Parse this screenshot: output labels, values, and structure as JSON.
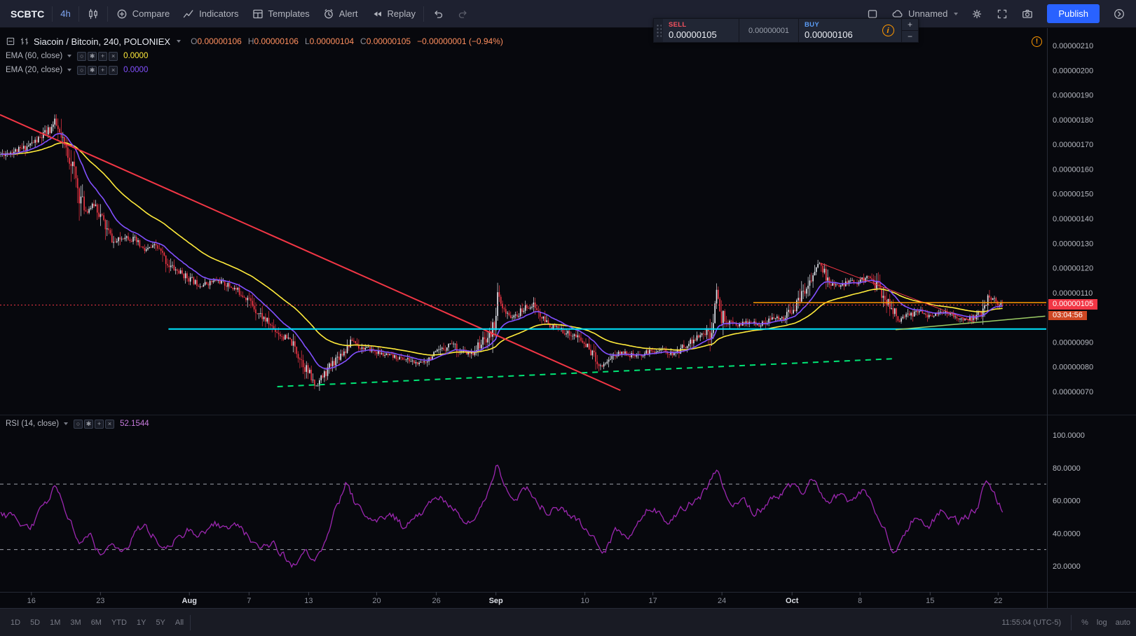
{
  "toolbar": {
    "symbol": "SCBTC",
    "interval": "4h",
    "compare_label": "Compare",
    "indicators_label": "Indicators",
    "templates_label": "Templates",
    "alert_label": "Alert",
    "replay_label": "Replay",
    "layout_name": "Unnamed",
    "publish_label": "Publish"
  },
  "order_panel": {
    "sell_label": "SELL",
    "sell_price": "0.00000105",
    "spread": "0.00000001",
    "buy_label": "BUY",
    "buy_price": "0.00000106",
    "info_glyph": "i",
    "step_up": "+",
    "step_down": "−"
  },
  "legend": {
    "title": "Siacoin / Bitcoin, 240, POLONIEX",
    "ohlc": {
      "o_key": "O",
      "o": "0.00000106",
      "h_key": "H",
      "h": "0.00000106",
      "l_key": "L",
      "l": "0.00000104",
      "c_key": "C",
      "c": "0.00000105",
      "change": "−0.00000001 (−0.94%)"
    },
    "indicator_buttons": [
      "○",
      "✱",
      "+",
      "×"
    ],
    "indicators": {
      "ema60_label": "EMA (60, close)",
      "ema60_value": "0.0000",
      "ema20_label": "EMA (20, close)",
      "ema20_value": "0.0000",
      "rsi_label": "RSI (14, close)",
      "rsi_value": "52.1544"
    },
    "warning_glyph": "!"
  },
  "price_scale": {
    "labels": [
      {
        "p": 210,
        "label": "0.00000210"
      },
      {
        "p": 200,
        "label": "0.00000200"
      },
      {
        "p": 190,
        "label": "0.00000190"
      },
      {
        "p": 180,
        "label": "0.00000180"
      },
      {
        "p": 170,
        "label": "0.00000170"
      },
      {
        "p": 160,
        "label": "0.00000160"
      },
      {
        "p": 150,
        "label": "0.00000150"
      },
      {
        "p": 140,
        "label": "0.00000140"
      },
      {
        "p": 130,
        "label": "0.00000130"
      },
      {
        "p": 120,
        "label": "0.00000120"
      },
      {
        "p": 110,
        "label": "0.00000110"
      },
      {
        "p": 90,
        "label": "0.00000090"
      },
      {
        "p": 80,
        "label": "0.00000080"
      },
      {
        "p": 70,
        "label": "0.00000070"
      }
    ],
    "last_price_badge": "0.00000105",
    "countdown_badge": "03:04:56"
  },
  "rsi_scale": {
    "labels": [
      {
        "v": 100,
        "label": "100.0000"
      },
      {
        "v": 80,
        "label": "80.0000"
      },
      {
        "v": 60,
        "label": "60.0000"
      },
      {
        "v": 40,
        "label": "40.0000"
      },
      {
        "v": 20,
        "label": "20.0000"
      }
    ]
  },
  "time_axis": {
    "labels": [
      {
        "x": 0.03,
        "label": "16",
        "major": false
      },
      {
        "x": 0.096,
        "label": "23",
        "major": false
      },
      {
        "x": 0.181,
        "label": "Aug",
        "major": true
      },
      {
        "x": 0.238,
        "label": "7",
        "major": false
      },
      {
        "x": 0.295,
        "label": "13",
        "major": false
      },
      {
        "x": 0.36,
        "label": "20",
        "major": false
      },
      {
        "x": 0.417,
        "label": "26",
        "major": false
      },
      {
        "x": 0.474,
        "label": "Sep",
        "major": true
      },
      {
        "x": 0.559,
        "label": "10",
        "major": false
      },
      {
        "x": 0.624,
        "label": "17",
        "major": false
      },
      {
        "x": 0.69,
        "label": "24",
        "major": false
      },
      {
        "x": 0.757,
        "label": "Oct",
        "major": true
      },
      {
        "x": 0.822,
        "label": "8",
        "major": false
      },
      {
        "x": 0.889,
        "label": "15",
        "major": false
      },
      {
        "x": 0.954,
        "label": "22",
        "major": false
      }
    ]
  },
  "bottom_bar": {
    "ranges": [
      "1D",
      "5D",
      "1M",
      "3M",
      "6M",
      "YTD",
      "1Y",
      "5Y",
      "All"
    ],
    "clock": "11:55:04 (UTC-5)",
    "percent_label": "%",
    "log_label": "log",
    "auto_label": "auto"
  },
  "chart_data": {
    "type": "candlestick",
    "title": "Siacoin / Bitcoin, 240, POLONIEX",
    "pair": "SC/BTC",
    "exchange": "POLONIEX",
    "interval_minutes": 240,
    "last": {
      "o": "0.00000106",
      "h": "0.00000106",
      "l": "0.00000104",
      "c": "0.00000105",
      "change": "−0.00000001",
      "change_pct": "−0.94%"
    },
    "price_axis": {
      "min_e8": 70,
      "max_e8": 210,
      "tick_e8": 10,
      "note": "prices are BTC x 1e-8"
    },
    "rsi_last": 52.1544,
    "rsi_bands": [
      70,
      30
    ],
    "candle_count": 614,
    "candles_span": 0.959,
    "seed": 11,
    "colors": {
      "up": "#e4e7ee",
      "down": "#f23645",
      "ema60": "#ffeb3b",
      "ema20": "#8250ff",
      "rsi": "#9c27b0",
      "support": "#00e5ff",
      "trend_red": "#f23645",
      "trend_green_dashed": "#00e676",
      "trend_green": "#9ccc65",
      "ray_orange": "#ff9800"
    },
    "price_path_e8": [
      [
        0,
        166
      ],
      [
        0.021,
        168
      ],
      [
        0.038,
        172
      ],
      [
        0.049,
        176
      ],
      [
        0.054,
        179
      ],
      [
        0.061,
        171
      ],
      [
        0.07,
        164
      ],
      [
        0.078,
        150
      ],
      [
        0.085,
        143
      ],
      [
        0.094,
        146
      ],
      [
        0.105,
        136
      ],
      [
        0.113,
        130
      ],
      [
        0.124,
        133
      ],
      [
        0.134,
        131
      ],
      [
        0.143,
        127
      ],
      [
        0.155,
        129
      ],
      [
        0.168,
        121
      ],
      [
        0.183,
        117
      ],
      [
        0.199,
        113
      ],
      [
        0.216,
        115
      ],
      [
        0.232,
        112
      ],
      [
        0.246,
        108
      ],
      [
        0.257,
        102
      ],
      [
        0.269,
        97
      ],
      [
        0.279,
        93
      ],
      [
        0.29,
        90
      ],
      [
        0.3,
        83
      ],
      [
        0.309,
        76
      ],
      [
        0.314,
        72
      ],
      [
        0.323,
        77
      ],
      [
        0.334,
        83
      ],
      [
        0.344,
        87
      ],
      [
        0.351,
        91
      ],
      [
        0.358,
        88
      ],
      [
        0.369,
        87
      ],
      [
        0.381,
        85
      ],
      [
        0.392,
        84
      ],
      [
        0.405,
        83
      ],
      [
        0.418,
        81
      ],
      [
        0.429,
        84
      ],
      [
        0.441,
        87
      ],
      [
        0.45,
        90
      ],
      [
        0.459,
        86
      ],
      [
        0.469,
        85
      ],
      [
        0.48,
        90
      ],
      [
        0.489,
        93
      ],
      [
        0.493,
        98
      ],
      [
        0.496,
        109
      ],
      [
        0.5,
        104
      ],
      [
        0.504,
        101
      ],
      [
        0.513,
        100
      ],
      [
        0.524,
        104
      ],
      [
        0.532,
        105
      ],
      [
        0.541,
        99
      ],
      [
        0.552,
        96
      ],
      [
        0.564,
        94
      ],
      [
        0.576,
        92
      ],
      [
        0.588,
        87
      ],
      [
        0.599,
        80
      ],
      [
        0.609,
        84
      ],
      [
        0.621,
        86
      ],
      [
        0.634,
        84
      ],
      [
        0.646,
        86
      ],
      [
        0.66,
        87
      ],
      [
        0.672,
        85
      ],
      [
        0.684,
        89
      ],
      [
        0.697,
        92
      ],
      [
        0.707,
        95
      ],
      [
        0.711,
        98
      ],
      [
        0.714,
        113
      ],
      [
        0.718,
        101
      ],
      [
        0.726,
        98
      ],
      [
        0.737,
        97
      ],
      [
        0.747,
        98
      ],
      [
        0.758,
        97
      ],
      [
        0.768,
        99
      ],
      [
        0.781,
        100
      ],
      [
        0.793,
        104
      ],
      [
        0.804,
        112
      ],
      [
        0.817,
        122
      ],
      [
        0.826,
        114
      ],
      [
        0.837,
        112
      ],
      [
        0.847,
        115
      ],
      [
        0.857,
        114
      ],
      [
        0.866,
        117
      ],
      [
        0.876,
        112
      ],
      [
        0.887,
        105
      ],
      [
        0.897,
        99
      ],
      [
        0.908,
        101
      ],
      [
        0.918,
        103
      ],
      [
        0.929,
        100
      ],
      [
        0.939,
        102
      ],
      [
        0.95,
        101
      ],
      [
        0.96,
        99
      ],
      [
        0.971,
        100
      ],
      [
        0.979,
        102
      ],
      [
        0.983,
        104
      ],
      [
        0.986,
        110
      ],
      [
        0.99,
        107
      ],
      [
        0.995,
        106
      ],
      [
        1,
        105
      ]
    ],
    "rsi_path": [
      [
        0,
        52
      ],
      [
        0.028,
        44
      ],
      [
        0.043,
        58
      ],
      [
        0.054,
        70
      ],
      [
        0.066,
        48
      ],
      [
        0.078,
        32
      ],
      [
        0.089,
        38
      ],
      [
        0.099,
        24
      ],
      [
        0.11,
        36
      ],
      [
        0.12,
        26
      ],
      [
        0.131,
        38
      ],
      [
        0.141,
        46
      ],
      [
        0.152,
        38
      ],
      [
        0.164,
        32
      ],
      [
        0.176,
        36
      ],
      [
        0.187,
        44
      ],
      [
        0.199,
        38
      ],
      [
        0.211,
        48
      ],
      [
        0.222,
        42
      ],
      [
        0.234,
        46
      ],
      [
        0.246,
        38
      ],
      [
        0.257,
        30
      ],
      [
        0.269,
        34
      ],
      [
        0.281,
        26
      ],
      [
        0.292,
        20
      ],
      [
        0.304,
        28
      ],
      [
        0.314,
        24
      ],
      [
        0.325,
        42
      ],
      [
        0.335,
        58
      ],
      [
        0.344,
        72
      ],
      [
        0.353,
        56
      ],
      [
        0.363,
        50
      ],
      [
        0.376,
        46
      ],
      [
        0.388,
        52
      ],
      [
        0.399,
        44
      ],
      [
        0.412,
        48
      ],
      [
        0.425,
        56
      ],
      [
        0.436,
        62
      ],
      [
        0.447,
        58
      ],
      [
        0.457,
        50
      ],
      [
        0.469,
        46
      ],
      [
        0.482,
        60
      ],
      [
        0.494,
        85
      ],
      [
        0.503,
        66
      ],
      [
        0.513,
        60
      ],
      [
        0.524,
        68
      ],
      [
        0.534,
        58
      ],
      [
        0.546,
        52
      ],
      [
        0.559,
        56
      ],
      [
        0.571,
        48
      ],
      [
        0.583,
        42
      ],
      [
        0.595,
        34
      ],
      [
        0.602,
        28
      ],
      [
        0.613,
        44
      ],
      [
        0.625,
        38
      ],
      [
        0.637,
        50
      ],
      [
        0.649,
        56
      ],
      [
        0.662,
        46
      ],
      [
        0.674,
        52
      ],
      [
        0.686,
        58
      ],
      [
        0.698,
        64
      ],
      [
        0.709,
        74
      ],
      [
        0.714,
        82
      ],
      [
        0.725,
        56
      ],
      [
        0.737,
        62
      ],
      [
        0.749,
        52
      ],
      [
        0.761,
        57
      ],
      [
        0.774,
        62
      ],
      [
        0.786,
        70
      ],
      [
        0.797,
        64
      ],
      [
        0.81,
        74
      ],
      [
        0.823,
        56
      ],
      [
        0.834,
        64
      ],
      [
        0.846,
        58
      ],
      [
        0.859,
        66
      ],
      [
        0.871,
        52
      ],
      [
        0.881,
        42
      ],
      [
        0.89,
        28
      ],
      [
        0.901,
        42
      ],
      [
        0.913,
        50
      ],
      [
        0.925,
        44
      ],
      [
        0.937,
        54
      ],
      [
        0.95,
        46
      ],
      [
        0.962,
        50
      ],
      [
        0.974,
        56
      ],
      [
        0.983,
        74
      ],
      [
        0.992,
        62
      ],
      [
        1,
        52
      ]
    ],
    "overlays": [
      {
        "name": "downtrend-line-main",
        "color": "#f23645",
        "width": 2,
        "dash": "",
        "x1": 0.0,
        "p1": 182,
        "x2": 0.593,
        "p2": 70.5
      },
      {
        "name": "downtrend-line-oct",
        "color": "#f23645",
        "width": 1,
        "dash": "",
        "x1": 0.784,
        "p1": 122,
        "x2": 0.932,
        "p2": 98
      },
      {
        "name": "support-line-cyan",
        "color": "#00e5ff",
        "width": 2,
        "dash": "",
        "x1": 0.161,
        "p1": 95.3,
        "x2": 1.0,
        "p2": 95.3
      },
      {
        "name": "uptrend-line-dashed",
        "color": "#00e676",
        "width": 2,
        "dash": "8 7",
        "x1": 0.265,
        "p1": 72,
        "x2": 0.855,
        "p2": 83.3
      },
      {
        "name": "minor-uptrend-line",
        "color": "#9ccc65",
        "width": 1.5,
        "dash": "",
        "x1": 0.856,
        "p1": 95,
        "x2": 0.999,
        "p2": 100.5
      },
      {
        "name": "horizontal-ray-orange",
        "color": "#ff9800",
        "width": 1.5,
        "dash": "",
        "x1": 0.72,
        "p1": 106,
        "x2": 1.0,
        "p2": 106
      },
      {
        "name": "last-price-line",
        "color": "#f23645",
        "width": 1,
        "dash": "2 3",
        "x1": 0.0,
        "p1": 105,
        "x2": 1.0,
        "p2": 105
      }
    ]
  }
}
